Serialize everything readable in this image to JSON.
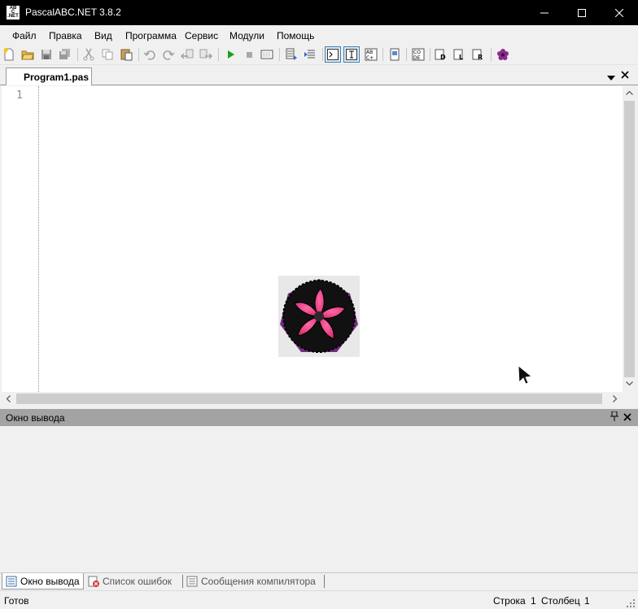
{
  "window": {
    "title": "PascalABC.NET 3.8.2",
    "app_icon_text": "AB\nC.NET"
  },
  "menu": {
    "items": [
      "Файл",
      "Правка",
      "Вид",
      "Программа",
      "Сервис",
      "Модули",
      "Помощь"
    ]
  },
  "toolbar": {
    "icons": [
      "new-file-icon",
      "open-icon",
      "save-icon",
      "save-all-icon",
      "cut-icon",
      "copy-icon",
      "paste-icon",
      "undo-icon",
      "redo-icon",
      "back-icon",
      "forward-icon",
      "run-icon",
      "stop-icon",
      "compile-icon",
      "debug-step-icon",
      "debug-step-over-icon",
      "console-icon",
      "text-icon",
      "abc-icon",
      "form-icon",
      "code-icon",
      "debug-d-icon",
      "debug-l-icon",
      "debug-r-icon",
      "flower-icon"
    ]
  },
  "editor": {
    "tab_label": "Program1.pas",
    "line_numbers": [
      "1"
    ]
  },
  "output": {
    "title": "Окно вывода"
  },
  "bottom_tabs": {
    "output": "Окно вывода",
    "errors": "Список ошибок",
    "compiler": "Сообщения компилятора"
  },
  "status": {
    "ready": "Готов",
    "line_label": "Строка",
    "line_value": "1",
    "col_label": "Столбец",
    "col_value": "1"
  },
  "colors": {
    "titlebar": "#000000",
    "output_header": "#a3a3a3",
    "accent_pink": "#e83e7c",
    "splash_purple": "#7a3a8a"
  }
}
